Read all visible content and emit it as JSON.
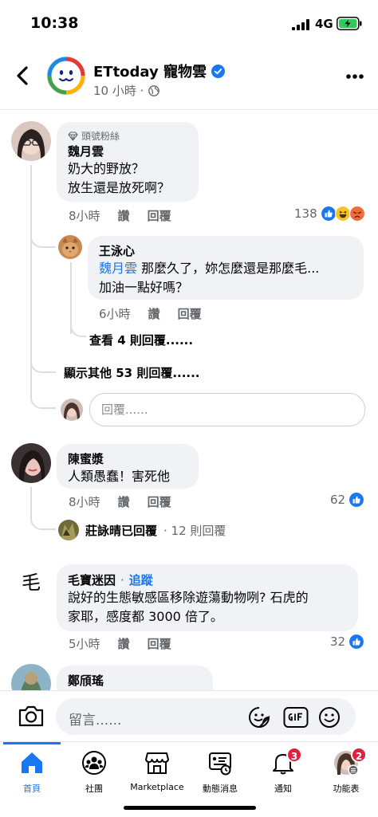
{
  "status": {
    "time": "10:38",
    "network": "4G"
  },
  "header": {
    "title": "ETtoday 寵物雲",
    "meta": "10 小時 ·"
  },
  "comments": [
    {
      "badge": "頭號粉絲",
      "author": "魏月雲",
      "lines": [
        "奶大的野放？",
        "放生還是放死啊？"
      ],
      "time": "8小時",
      "like": "讚",
      "reply": "回覆",
      "reaction_count": "138",
      "replies": [
        {
          "author": "王泳心",
          "mention": "魏月雲",
          "line1": " 那麼久了，妳怎麼還是那麼毛...",
          "line2": "加油一點好嗎？",
          "time": "6小時",
          "like": "讚",
          "reply": "回覆",
          "more": "查看 4 則回覆......"
        }
      ],
      "more_replies": "顯示其他 53 則回覆......",
      "reply_placeholder": "回覆......"
    },
    {
      "author": "陳蜜漿",
      "lines": [
        "人類愚蠢！害死他"
      ],
      "time": "8小時",
      "like": "讚",
      "reply": "回覆",
      "reaction_count": "62",
      "replied_by": "莊詠晴已回覆",
      "replied_count": "· 12 則回覆"
    },
    {
      "avatar_text": "毛",
      "author": "毛寶迷因",
      "follow": "追蹤",
      "lines": [
        "說好的生態敏感區移除遊蕩動物咧? 石虎的",
        "家耶，感度都 3000 倍了。"
      ],
      "time": "5小時",
      "like": "讚",
      "reply": "回覆",
      "reaction_count": "32"
    },
    {
      "author": "鄭頎瑤"
    }
  ],
  "composer": {
    "placeholder": "留言......"
  },
  "tabs": [
    {
      "label": "首頁",
      "icon": "home-icon"
    },
    {
      "label": "社團",
      "icon": "groups-icon"
    },
    {
      "label": "Marketplace",
      "icon": "marketplace-icon"
    },
    {
      "label": "動態消息",
      "icon": "feeds-icon"
    },
    {
      "label": "通知",
      "icon": "bell-icon",
      "badge": "3"
    },
    {
      "label": "功能表",
      "icon": "menu-avatar-icon",
      "badge": "2"
    }
  ],
  "colors": {
    "accent": "#1877f2",
    "badge": "#e41e3f",
    "bubble": "#f0f2f5",
    "secondary_text": "#65676b"
  }
}
